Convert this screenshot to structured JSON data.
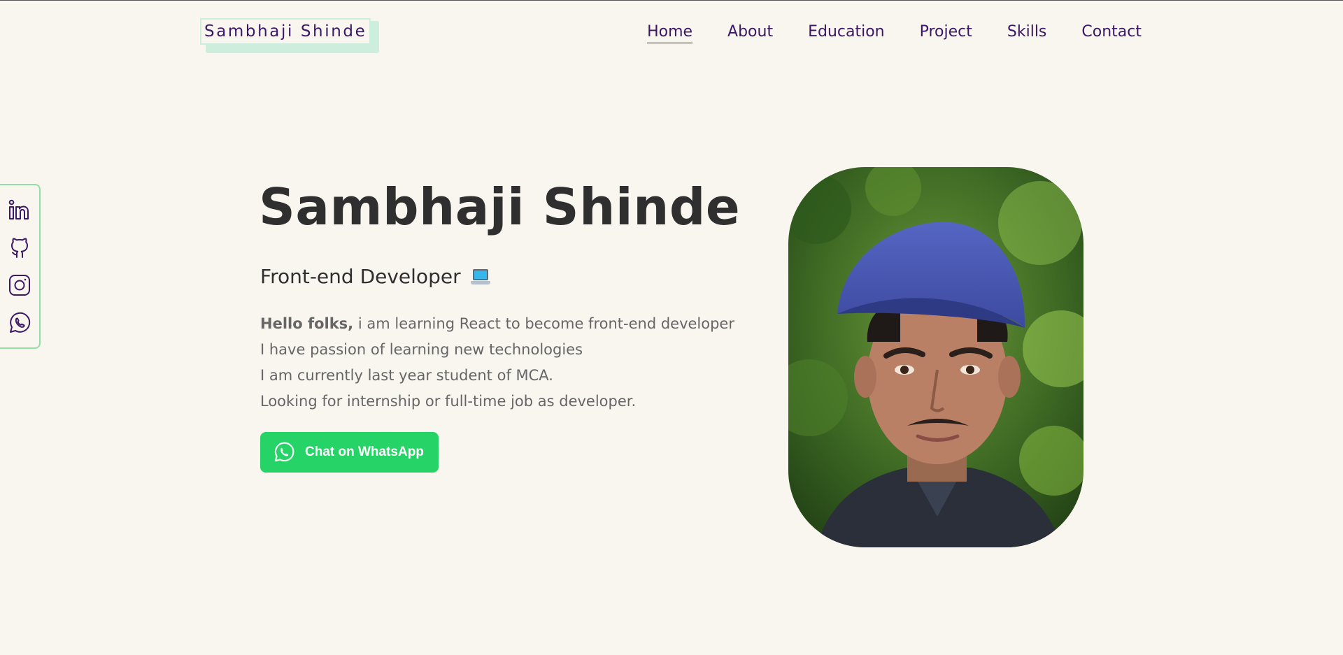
{
  "header": {
    "logo_text": "Sambhaji Shinde",
    "nav": [
      {
        "label": "Home",
        "active": true
      },
      {
        "label": "About",
        "active": false
      },
      {
        "label": "Education",
        "active": false
      },
      {
        "label": "Project",
        "active": false
      },
      {
        "label": "Skills",
        "active": false
      },
      {
        "label": "Contact",
        "active": false
      }
    ]
  },
  "social": {
    "icons": [
      "linkedin-icon",
      "github-icon",
      "instagram-icon",
      "whatsapp-icon"
    ],
    "border_color": "#8fe0a3",
    "icon_color": "#3b1766"
  },
  "hero": {
    "name": "Sambhaji Shinde",
    "role": "Front-end Developer",
    "role_icon": "laptop-icon",
    "bio": {
      "greeting": "Hello folks,",
      "line1": " i am learning React to become front-end developer",
      "line2": "I have passion of learning new technologies",
      "line3": "I am currently last year student of MCA.",
      "line4": "Looking for internship or full-time job as developer."
    },
    "cta_label": "Chat on WhatsApp",
    "cta_color": "#25d366"
  },
  "colors": {
    "background": "#f9f6f0",
    "accent": "#3b1766",
    "logo_shadow": "#cdeedd",
    "heading": "#2f2f2f",
    "body_text": "#666666"
  }
}
